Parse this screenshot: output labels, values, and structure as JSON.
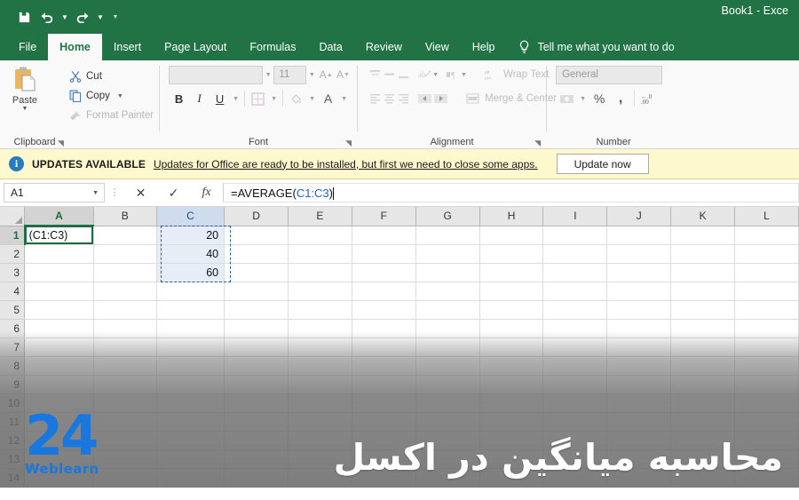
{
  "window": {
    "title": "Book1  -  Exce",
    "accent_color": "#217346"
  },
  "quick_access": {
    "items": [
      {
        "name": "save-icon",
        "label": "Save"
      },
      {
        "name": "undo-icon",
        "label": "Undo"
      },
      {
        "name": "redo-icon",
        "label": "Redo"
      },
      {
        "name": "customize-qat-icon",
        "label": "Customize Quick Access Toolbar"
      }
    ]
  },
  "tabs": [
    {
      "label": "File",
      "active": false
    },
    {
      "label": "Home",
      "active": true
    },
    {
      "label": "Insert",
      "active": false
    },
    {
      "label": "Page Layout",
      "active": false
    },
    {
      "label": "Formulas",
      "active": false
    },
    {
      "label": "Data",
      "active": false
    },
    {
      "label": "Review",
      "active": false
    },
    {
      "label": "View",
      "active": false
    },
    {
      "label": "Help",
      "active": false
    }
  ],
  "tell_me": {
    "label": "Tell me what you want to do",
    "icon": "lightbulb-icon"
  },
  "ribbon": {
    "clipboard": {
      "label": "Clipboard",
      "paste_label": "Paste",
      "cut_label": "Cut",
      "copy_label": "Copy",
      "format_painter_label": "Format Painter"
    },
    "font": {
      "label": "Font",
      "font_name_value": "",
      "font_size_value": "11",
      "bold_label": "B",
      "italic_label": "I",
      "underline_label": "U",
      "grow_font_label": "A",
      "shrink_font_label": "A",
      "font_color_label": "A"
    },
    "alignment": {
      "label": "Alignment",
      "wrap_text_label": "Wrap Text",
      "merge_center_label": "Merge & Center"
    },
    "number": {
      "label": "Number",
      "format_value": "General",
      "percent_label": "%",
      "comma_label": ",",
      "decimal_label": ".00"
    }
  },
  "notification": {
    "icon": "info-icon",
    "heading": "UPDATES AVAILABLE",
    "message": "Updates for Office are ready to be installed, but first we need to close some apps.",
    "button_label": "Update now"
  },
  "formula_bar": {
    "name_box_value": "A1",
    "cancel_label": "✕",
    "enter_label": "✓",
    "fx_label": "fx",
    "formula_prefix": "=AVERAGE(",
    "formula_reference": "C1:C3",
    "formula_suffix": ")"
  },
  "sheet": {
    "columns": [
      {
        "label": "A",
        "width": 79,
        "state": "active"
      },
      {
        "label": "B",
        "width": 74,
        "state": "normal"
      },
      {
        "label": "C",
        "width": 79,
        "state": "selected"
      },
      {
        "label": "D",
        "width": 75,
        "state": "normal"
      },
      {
        "label": "E",
        "width": 75,
        "state": "normal"
      },
      {
        "label": "F",
        "width": 75,
        "state": "normal"
      },
      {
        "label": "G",
        "width": 75,
        "state": "normal"
      },
      {
        "label": "H",
        "width": 75,
        "state": "normal"
      },
      {
        "label": "I",
        "width": 75,
        "state": "normal"
      },
      {
        "label": "J",
        "width": 75,
        "state": "normal"
      },
      {
        "label": "K",
        "width": 75,
        "state": "normal"
      },
      {
        "label": "L",
        "width": 75,
        "state": "normal"
      }
    ],
    "rows": [
      {
        "label": "1",
        "state": "active",
        "cells": [
          "(C1:C3)",
          "",
          "20",
          "",
          "",
          "",
          "",
          "",
          "",
          "",
          "",
          ""
        ]
      },
      {
        "label": "2",
        "state": "normal",
        "cells": [
          "",
          "",
          "40",
          "",
          "",
          "",
          "",
          "",
          "",
          "",
          "",
          ""
        ]
      },
      {
        "label": "3",
        "state": "normal",
        "cells": [
          "",
          "",
          "60",
          "",
          "",
          "",
          "",
          "",
          "",
          "",
          "",
          ""
        ]
      },
      {
        "label": "4",
        "state": "normal",
        "cells": [
          "",
          "",
          "",
          "",
          "",
          "",
          "",
          "",
          "",
          "",
          "",
          ""
        ]
      },
      {
        "label": "5",
        "state": "normal",
        "cells": [
          "",
          "",
          "",
          "",
          "",
          "",
          "",
          "",
          "",
          "",
          "",
          ""
        ]
      },
      {
        "label": "6",
        "state": "normal",
        "cells": [
          "",
          "",
          "",
          "",
          "",
          "",
          "",
          "",
          "",
          "",
          "",
          ""
        ]
      },
      {
        "label": "7",
        "state": "normal",
        "cells": [
          "",
          "",
          "",
          "",
          "",
          "",
          "",
          "",
          "",
          "",
          "",
          ""
        ]
      },
      {
        "label": "8",
        "state": "normal",
        "cells": [
          "",
          "",
          "",
          "",
          "",
          "",
          "",
          "",
          "",
          "",
          "",
          ""
        ]
      },
      {
        "label": "9",
        "state": "normal",
        "cells": [
          "",
          "",
          "",
          "",
          "",
          "",
          "",
          "",
          "",
          "",
          "",
          ""
        ]
      },
      {
        "label": "10",
        "state": "normal",
        "cells": [
          "",
          "",
          "",
          "",
          "",
          "",
          "",
          "",
          "",
          "",
          "",
          ""
        ]
      },
      {
        "label": "11",
        "state": "normal",
        "cells": [
          "",
          "",
          "",
          "",
          "",
          "",
          "",
          "",
          "",
          "",
          "",
          ""
        ]
      },
      {
        "label": "12",
        "state": "normal",
        "cells": [
          "",
          "",
          "",
          "",
          "",
          "",
          "",
          "",
          "",
          "",
          "",
          ""
        ]
      },
      {
        "label": "13",
        "state": "normal",
        "cells": [
          "",
          "",
          "",
          "",
          "",
          "",
          "",
          "",
          "",
          "",
          "",
          ""
        ]
      },
      {
        "label": "14",
        "state": "normal",
        "cells": [
          "",
          "",
          "",
          "",
          "",
          "",
          "",
          "",
          "",
          "",
          "",
          ""
        ]
      }
    ],
    "editing_cell": "A1",
    "selection_range": "C1:C3"
  },
  "overlay": {
    "caption_text": "محاسبه میانگین در اکسل",
    "logo_number": "24",
    "logo_word": "Weblearn",
    "logo_color": "#1878e0"
  }
}
